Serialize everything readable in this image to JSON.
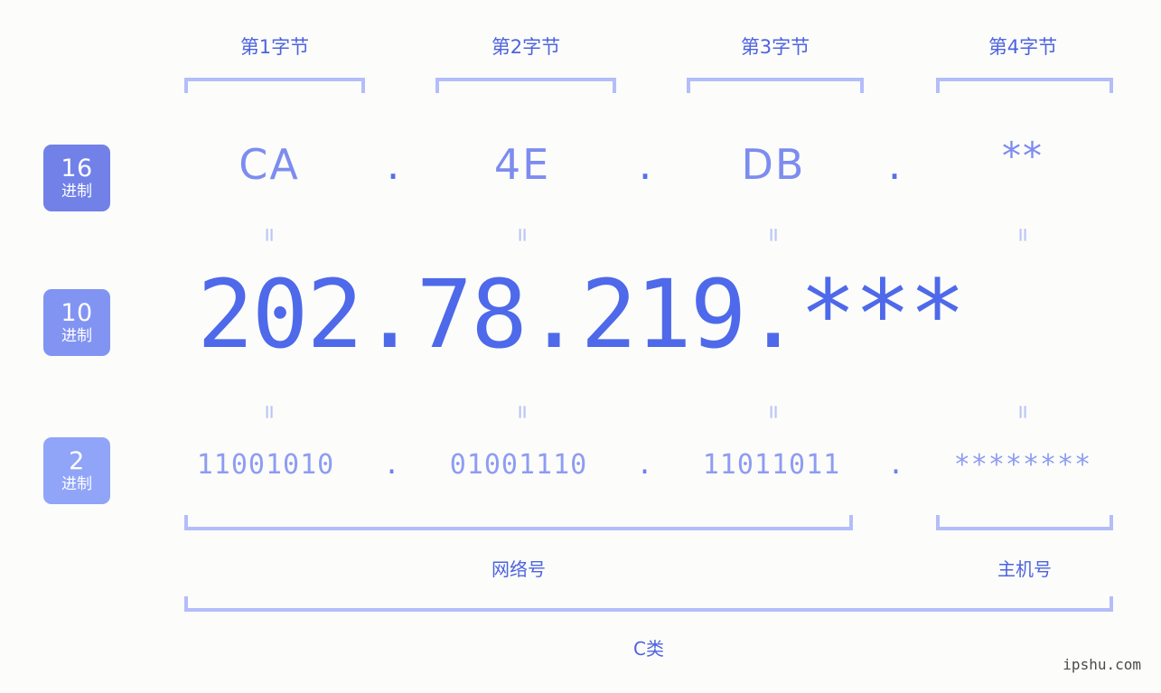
{
  "page": {
    "background_color": "#fcfdfa",
    "accent_color": "#4e63e0",
    "light_accent_color": "#b4bdfa",
    "watermark": "ipshu.com"
  },
  "byte_headers": [
    {
      "label": "第1字节"
    },
    {
      "label": "第2字节"
    },
    {
      "label": "第3字节"
    },
    {
      "label": "第4字节"
    }
  ],
  "rows": {
    "hex": {
      "badge_number": "16",
      "badge_suffix": "进制",
      "badge_color": "#7181e8",
      "values": [
        "CA",
        "4E",
        "DB",
        "**"
      ],
      "separator": "."
    },
    "decimal": {
      "badge_number": "10",
      "badge_suffix": "进制",
      "badge_color": "#8294f2",
      "values": [
        "202",
        "78",
        "219",
        "***"
      ],
      "separator": "."
    },
    "binary": {
      "badge_number": "2",
      "badge_suffix": "进制",
      "badge_color": "#90a4f8",
      "values": [
        "11001010",
        "01001110",
        "11011011",
        "********"
      ],
      "separator": "."
    }
  },
  "equals_symbol": "=",
  "sections": [
    {
      "label": "网络号"
    },
    {
      "label": "主机号"
    }
  ],
  "class_label": "C类"
}
